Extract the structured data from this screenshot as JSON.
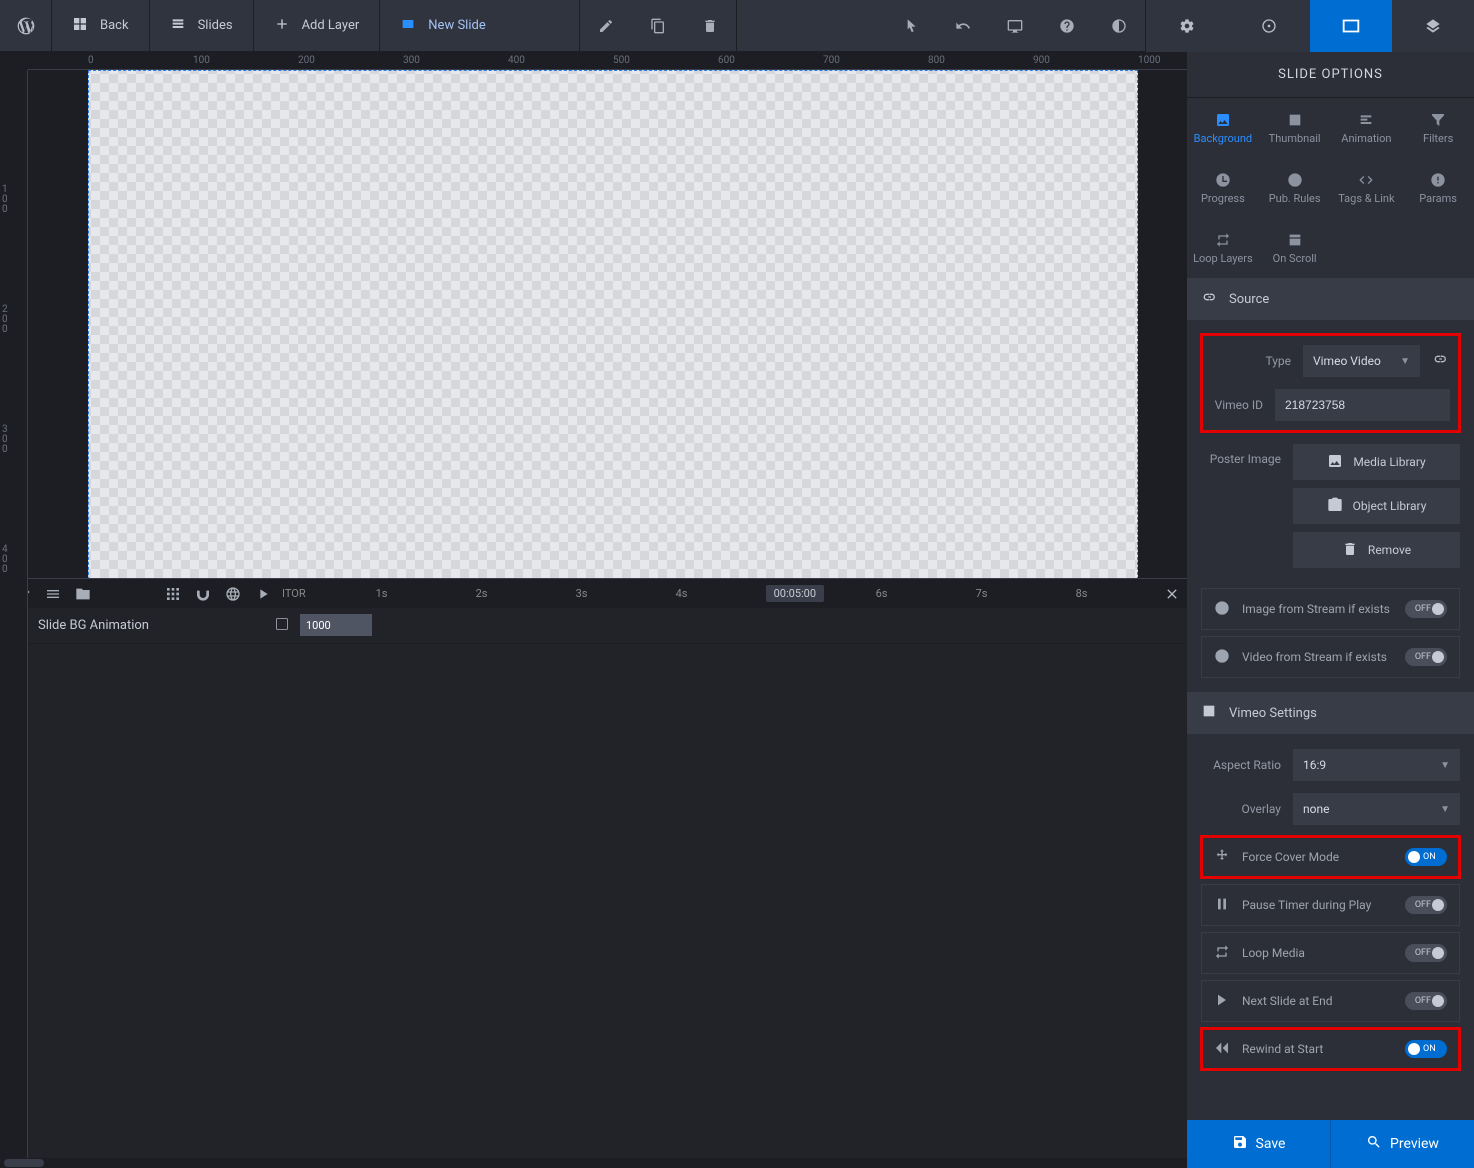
{
  "toolbar": {
    "back": "Back",
    "slides": "Slides",
    "add_layer": "Add Layer",
    "new_slide": "New Slide"
  },
  "ruler_h": [
    "0",
    "100",
    "200",
    "300",
    "400",
    "500",
    "600",
    "700",
    "800",
    "900",
    "1000"
  ],
  "ruler_v": [
    "100",
    "200",
    "300",
    "400"
  ],
  "timeline": {
    "editor_label": "ITOR",
    "ticks": [
      "1s",
      "2s",
      "3s",
      "4s",
      "6s",
      "7s",
      "8s"
    ],
    "current_time": "00:05:00",
    "row_label": "Slide BG Animation",
    "segment_value": "1000"
  },
  "sidebar": {
    "title": "SLIDE OPTIONS",
    "tabs_row1": [
      "Background",
      "Thumbnail",
      "Animation",
      "Filters"
    ],
    "tabs_row2": [
      "Progress",
      "Pub. Rules",
      "Tags & Link",
      "Params"
    ],
    "tabs_row3": [
      "Loop Layers",
      "On Scroll"
    ],
    "source": {
      "title": "Source",
      "type_label": "Type",
      "type_value": "Vimeo Video",
      "vimeo_id_label": "Vimeo ID",
      "vimeo_id_value": "218723758",
      "poster_label": "Poster Image",
      "media_library": "Media Library",
      "object_library": "Object Library",
      "remove": "Remove",
      "image_stream": "Image from Stream if exists",
      "image_stream_state": "OFF",
      "video_stream": "Video from Stream if exists",
      "video_stream_state": "OFF"
    },
    "vimeo": {
      "title": "Vimeo Settings",
      "aspect_label": "Aspect Ratio",
      "aspect_value": "16:9",
      "overlay_label": "Overlay",
      "overlay_value": "none",
      "force_cover": "Force Cover Mode",
      "force_cover_state": "ON",
      "pause_timer": "Pause Timer during Play",
      "pause_timer_state": "OFF",
      "loop_media": "Loop Media",
      "loop_media_state": "OFF",
      "next_slide": "Next Slide at End",
      "next_slide_state": "OFF",
      "rewind": "Rewind at Start",
      "rewind_state": "ON"
    },
    "save": "Save",
    "preview": "Preview"
  }
}
